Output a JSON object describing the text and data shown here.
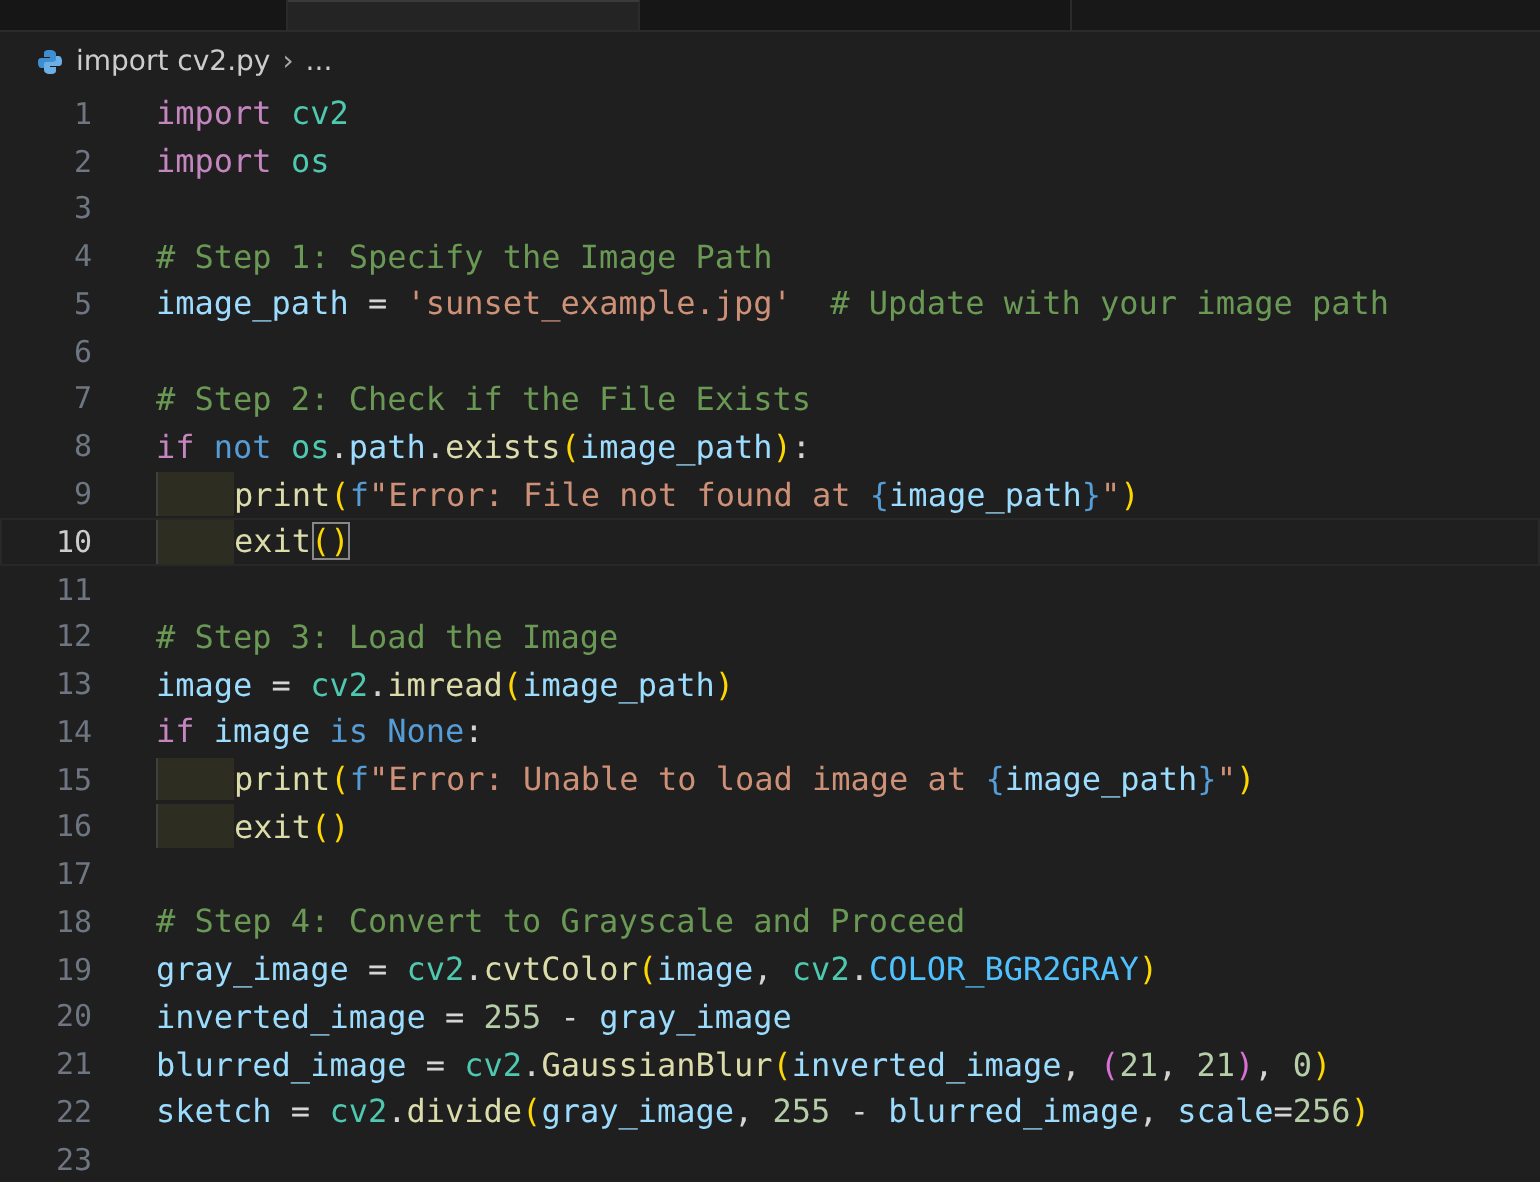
{
  "tabs": [
    {
      "selected": false
    },
    {
      "selected": true
    },
    {
      "selected": false
    }
  ],
  "breadcrumb": {
    "file": "import cv2.py",
    "separator": "›",
    "more": "..."
  },
  "lines": [
    {
      "n": "1",
      "current": false,
      "indented": false,
      "tokens": [
        {
          "t": "import ",
          "kind": "kw"
        },
        {
          "t": "cv2",
          "kind": "mod"
        }
      ]
    },
    {
      "n": "2",
      "current": false,
      "indented": false,
      "tokens": [
        {
          "t": "import ",
          "kind": "kw"
        },
        {
          "t": "os",
          "kind": "mod"
        }
      ]
    },
    {
      "n": "3",
      "current": false
    },
    {
      "n": "4",
      "current": false,
      "indented": false,
      "tokens": [
        {
          "t": "# Step 1: Specify the Image Path",
          "kind": "cm"
        }
      ]
    },
    {
      "n": "5",
      "current": false,
      "indented": false,
      "tokens": [
        {
          "t": "image_path",
          "kind": "var"
        },
        {
          "t": " = ",
          "kind": "op"
        },
        {
          "t": "'sunset_example.jpg'",
          "kind": "str"
        },
        {
          "t": "  # Update with your image path",
          "kind": "cm"
        }
      ]
    },
    {
      "n": "6",
      "current": false
    },
    {
      "n": "7",
      "current": false,
      "indented": false,
      "tokens": [
        {
          "t": "# Step 2: Check if the File Exists",
          "kind": "cm"
        }
      ]
    },
    {
      "n": "8",
      "current": false,
      "indented": false,
      "tokens": [
        {
          "t": "if ",
          "kind": "kw"
        },
        {
          "t": "not ",
          "kind": "kw2"
        },
        {
          "t": "os",
          "kind": "mod"
        },
        {
          "t": ".",
          "kind": "op"
        },
        {
          "t": "path",
          "kind": "var"
        },
        {
          "t": ".",
          "kind": "op"
        },
        {
          "t": "exists",
          "kind": "fn"
        },
        {
          "t": "(",
          "kind": "br"
        },
        {
          "t": "image_path",
          "kind": "var"
        },
        {
          "t": ")",
          "kind": "br"
        },
        {
          "t": ":",
          "kind": "op"
        }
      ]
    },
    {
      "n": "9",
      "current": false,
      "indented": true,
      "tokens": [
        {
          "t": "print",
          "kind": "fn"
        },
        {
          "t": "(",
          "kind": "br"
        },
        {
          "t": "f",
          "kind": "kw2"
        },
        {
          "t": "\"Error: File not found at ",
          "kind": "str"
        },
        {
          "t": "{",
          "kind": "fb"
        },
        {
          "t": "image_path",
          "kind": "var"
        },
        {
          "t": "}",
          "kind": "fb"
        },
        {
          "t": "\"",
          "kind": "str"
        },
        {
          "t": ")",
          "kind": "br"
        }
      ]
    },
    {
      "n": "10",
      "current": true,
      "indented": true,
      "tokens": [
        {
          "t": "exit",
          "kind": "fn"
        },
        {
          "t": "()",
          "kind": "brm"
        }
      ]
    },
    {
      "n": "11",
      "current": false
    },
    {
      "n": "12",
      "current": false,
      "indented": false,
      "tokens": [
        {
          "t": "# Step 3: Load the Image",
          "kind": "cm"
        }
      ]
    },
    {
      "n": "13",
      "current": false,
      "indented": false,
      "tokens": [
        {
          "t": "image",
          "kind": "var"
        },
        {
          "t": " = ",
          "kind": "op"
        },
        {
          "t": "cv2",
          "kind": "mod"
        },
        {
          "t": ".",
          "kind": "op"
        },
        {
          "t": "imread",
          "kind": "fn"
        },
        {
          "t": "(",
          "kind": "br"
        },
        {
          "t": "image_path",
          "kind": "var"
        },
        {
          "t": ")",
          "kind": "br"
        }
      ]
    },
    {
      "n": "14",
      "current": false,
      "indented": false,
      "tokens": [
        {
          "t": "if ",
          "kind": "kw"
        },
        {
          "t": "image ",
          "kind": "var"
        },
        {
          "t": "is None",
          "kind": "kw2"
        },
        {
          "t": ":",
          "kind": "op"
        }
      ]
    },
    {
      "n": "15",
      "current": false,
      "indented": true,
      "tokens": [
        {
          "t": "print",
          "kind": "fn"
        },
        {
          "t": "(",
          "kind": "br"
        },
        {
          "t": "f",
          "kind": "kw2"
        },
        {
          "t": "\"Error: Unable to load image at ",
          "kind": "str"
        },
        {
          "t": "{",
          "kind": "fb"
        },
        {
          "t": "image_path",
          "kind": "var"
        },
        {
          "t": "}",
          "kind": "fb"
        },
        {
          "t": "\"",
          "kind": "str"
        },
        {
          "t": ")",
          "kind": "br"
        }
      ]
    },
    {
      "n": "16",
      "current": false,
      "indented": true,
      "tokens": [
        {
          "t": "exit",
          "kind": "fn"
        },
        {
          "t": "()",
          "kind": "br"
        }
      ]
    },
    {
      "n": "17",
      "current": false
    },
    {
      "n": "18",
      "current": false,
      "indented": false,
      "tokens": [
        {
          "t": "# Step 4: Convert to Grayscale and Proceed",
          "kind": "cm"
        }
      ]
    },
    {
      "n": "19",
      "current": false,
      "indented": false,
      "tokens": [
        {
          "t": "gray_image",
          "kind": "var"
        },
        {
          "t": " = ",
          "kind": "op"
        },
        {
          "t": "cv2",
          "kind": "mod"
        },
        {
          "t": ".",
          "kind": "op"
        },
        {
          "t": "cvtColor",
          "kind": "fn"
        },
        {
          "t": "(",
          "kind": "br"
        },
        {
          "t": "image",
          "kind": "var"
        },
        {
          "t": ", ",
          "kind": "op"
        },
        {
          "t": "cv2",
          "kind": "mod"
        },
        {
          "t": ".",
          "kind": "op"
        },
        {
          "t": "COLOR_BGR2GRAY",
          "kind": "const"
        },
        {
          "t": ")",
          "kind": "br"
        }
      ]
    },
    {
      "n": "20",
      "current": false,
      "indented": false,
      "tokens": [
        {
          "t": "inverted_image",
          "kind": "var"
        },
        {
          "t": " = ",
          "kind": "op"
        },
        {
          "t": "255",
          "kind": "num"
        },
        {
          "t": " - ",
          "kind": "op"
        },
        {
          "t": "gray_image",
          "kind": "var"
        }
      ]
    },
    {
      "n": "21",
      "current": false,
      "indented": false,
      "tokens": [
        {
          "t": "blurred_image",
          "kind": "var"
        },
        {
          "t": " = ",
          "kind": "op"
        },
        {
          "t": "cv2",
          "kind": "mod"
        },
        {
          "t": ".",
          "kind": "op"
        },
        {
          "t": "GaussianBlur",
          "kind": "fn"
        },
        {
          "t": "(",
          "kind": "br"
        },
        {
          "t": "inverted_image",
          "kind": "var"
        },
        {
          "t": ", ",
          "kind": "op"
        },
        {
          "t": "(",
          "kind": "br2"
        },
        {
          "t": "21",
          "kind": "num"
        },
        {
          "t": ", ",
          "kind": "op"
        },
        {
          "t": "21",
          "kind": "num"
        },
        {
          "t": ")",
          "kind": "br2"
        },
        {
          "t": ", ",
          "kind": "op"
        },
        {
          "t": "0",
          "kind": "num"
        },
        {
          "t": ")",
          "kind": "br"
        }
      ]
    },
    {
      "n": "22",
      "current": false,
      "indented": false,
      "tokens": [
        {
          "t": "sketch",
          "kind": "var"
        },
        {
          "t": " = ",
          "kind": "op"
        },
        {
          "t": "cv2",
          "kind": "mod"
        },
        {
          "t": ".",
          "kind": "op"
        },
        {
          "t": "divide",
          "kind": "fn"
        },
        {
          "t": "(",
          "kind": "br"
        },
        {
          "t": "gray_image",
          "kind": "var"
        },
        {
          "t": ", ",
          "kind": "op"
        },
        {
          "t": "255",
          "kind": "num"
        },
        {
          "t": " - ",
          "kind": "op"
        },
        {
          "t": "blurred_image",
          "kind": "var"
        },
        {
          "t": ", ",
          "kind": "op"
        },
        {
          "t": "scale",
          "kind": "var"
        },
        {
          "t": "=",
          "kind": "op"
        },
        {
          "t": "256",
          "kind": "num"
        },
        {
          "t": ")",
          "kind": "br"
        }
      ]
    },
    {
      "n": "23",
      "current": false
    }
  ]
}
